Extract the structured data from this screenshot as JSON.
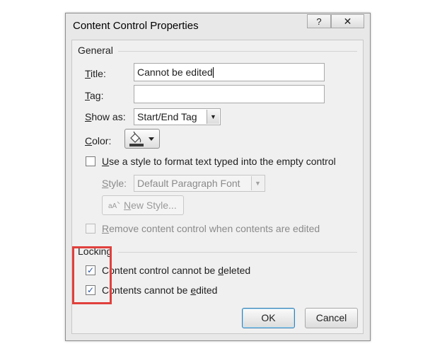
{
  "window": {
    "title": "Content Control Properties",
    "help_icon": "?",
    "close_icon": "✕"
  },
  "general": {
    "group_label": "General",
    "title_label_key": "T",
    "title_label_rest": "itle:",
    "title_value": "Cannot be edited",
    "tag_label_rest": "ag:",
    "tag_label_key": "T",
    "tag_value": "",
    "show_as_key": "S",
    "show_as_rest": "how as:",
    "show_as_value": "Start/End Tag",
    "color_key": "C",
    "color_rest": "olor:",
    "use_style_key": "U",
    "use_style_rest": "se a style to format text typed into the empty control",
    "use_style_checked": false,
    "style_key": "S",
    "style_rest": "tyle:",
    "style_value": "Default Paragraph Font",
    "new_style_key": "N",
    "new_style_rest": "ew Style...",
    "remove_key": "R",
    "remove_rest": "emove content control when contents are edited",
    "remove_checked": false
  },
  "locking": {
    "group_label": "Locking",
    "cannot_delete_pre": "Content control cannot be ",
    "cannot_delete_key": "d",
    "cannot_delete_post": "eleted",
    "cannot_delete_checked": true,
    "cannot_edit_pre": "Contents cannot be ",
    "cannot_edit_key": "e",
    "cannot_edit_post": "dited",
    "cannot_edit_checked": true
  },
  "buttons": {
    "ok": "OK",
    "cancel": "Cancel"
  },
  "colors": {
    "highlight": "#e0403c",
    "check": "#2b54a3",
    "default_button_border": "#3c7fb1"
  }
}
